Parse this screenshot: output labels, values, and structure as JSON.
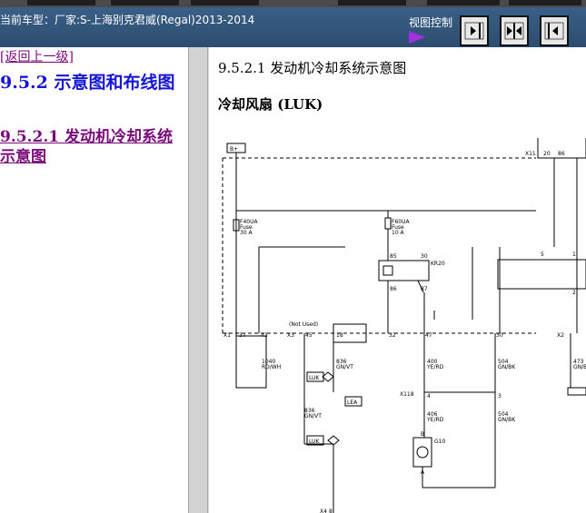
{
  "header": {
    "title": "当前车型：厂家:S-上海别克君威(Regal)2013-2014",
    "view_control_label": "视图控制",
    "view_buttons": [
      {
        "name": "view-right-icon"
      },
      {
        "name": "view-split-icon"
      },
      {
        "name": "view-left-icon"
      }
    ]
  },
  "nav": {
    "back_link": "[返回上一级]",
    "section_heading": "9.5.2 示意图和布线图",
    "subsection_link": "9.5.2.1 发动机冷却系统示意图"
  },
  "content": {
    "section_title": "9.5.2.1 发动机冷却系统示意图",
    "subsection_title": "冷却风扇 (LUK)"
  },
  "diagram": {
    "labels": {
      "battery": "B+",
      "fuse1_name": "F40UA",
      "fuse1_type": "Fuse",
      "fuse1_rating": "30 A",
      "fuse2_name": "F60UA",
      "fuse2_type": "Fuse",
      "fuse2_rating": "10 A",
      "relay_name": "KR20",
      "relay_term1": "85",
      "relay_term2": "30",
      "relay_term3": "86",
      "relay_term4": "87",
      "conn_x1": "X1",
      "conn_x11": "X11",
      "conn_x2": "X2",
      "conn_x3": "X3",
      "conn_x4": "X4",
      "conn_x118": "X118",
      "pin_37": "37",
      "pin_43": "43",
      "pin_45": "45",
      "pin_18": "18",
      "pin_32": "32",
      "pin_47": "47",
      "pin_20": "20",
      "pin_30": "30",
      "pin_4": "4",
      "pin_3": "3",
      "pin_5": "5",
      "pin_1": "1",
      "pin_2": "2",
      "not_used": "(Not Used)",
      "wire_1040": "1040",
      "wire_1040_color": "RD/WH",
      "wire_836a": "836",
      "wire_836a_color": "GN/VT",
      "wire_836b": "836",
      "wire_836b_color": "GN/VT",
      "wire_400": "400",
      "wire_400_color": "YE/RD",
      "wire_406": "406",
      "wire_406_color": "YE/RD",
      "wire_504a": "504",
      "wire_504a_color": "GN/BK",
      "wire_504b": "504",
      "wire_504b_color": "GN/BK",
      "wire_473": "473",
      "wire_473_color": "GN/BK",
      "luk1": "LUK",
      "luk2": "LUK",
      "lea": "LEA",
      "motor_id": "G10",
      "motor_term_b": "B",
      "motor_term_a": "A",
      "pin_8": "8",
      "pin_86": "86"
    }
  },
  "colors": {
    "title_bar": "#2c4d70",
    "heading_blue": "#1515d8",
    "link_purple": "#7a0a7a",
    "view_arrow": "#a030e0"
  }
}
